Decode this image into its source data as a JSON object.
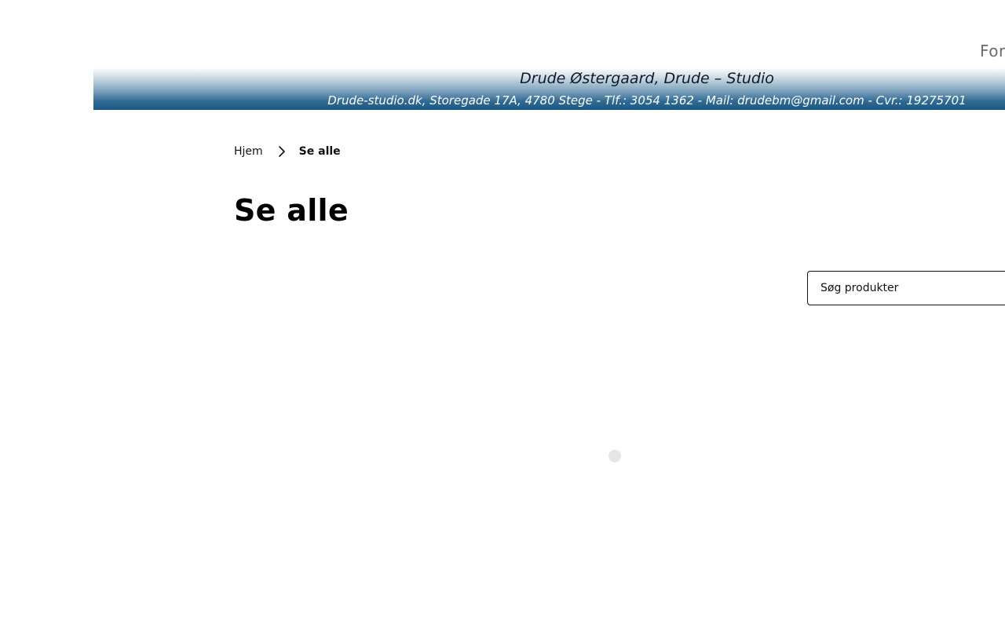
{
  "top_nav": {
    "partial_link": "For"
  },
  "header": {
    "title": "Drude Østergaard, Drude – Studio",
    "subtitle": "Drude-studio.dk, Storegade 17A, 4780 Stege - Tlf.: 3054 1362 - Mail: drudebm@gmail.com - Cvr.: 19275701"
  },
  "breadcrumb": {
    "home": "Hjem",
    "separator_icon": "chevron-right-icon",
    "current": "Se alle"
  },
  "page": {
    "title": "Se alle"
  },
  "search": {
    "placeholder": "Søg produkter"
  },
  "colors": {
    "banner_top": "#ffffff",
    "banner_bottom": "#1a5885",
    "nav_text": "#6b6b6b",
    "loading_dot": "#e6e6e6"
  }
}
